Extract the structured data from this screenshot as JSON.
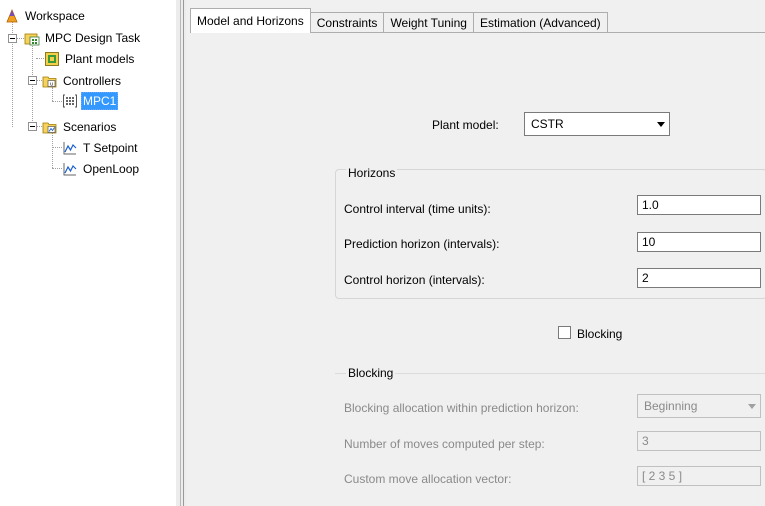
{
  "tree": {
    "workspace": "Workspace",
    "task": "MPC Design Task",
    "plant_models": "Plant models",
    "controllers": "Controllers",
    "controller": "MPC1",
    "scenarios": "Scenarios",
    "scenario_1": "T Setpoint",
    "scenario_2": "OpenLoop"
  },
  "tabs": [
    "Model and Horizons",
    "Constraints",
    "Weight Tuning",
    "Estimation (Advanced)"
  ],
  "plant": {
    "label": "Plant model:",
    "value": "CSTR"
  },
  "horizons": {
    "title": "Horizons",
    "control_interval": {
      "label": "Control interval (time units):",
      "value": "1.0"
    },
    "prediction_horizon": {
      "label": "Prediction horizon (intervals):",
      "value": "10"
    },
    "control_horizon": {
      "label": "Control horizon (intervals):",
      "value": "2"
    }
  },
  "blocking_checkbox": {
    "label": "Blocking",
    "checked": false
  },
  "blocking": {
    "title": "Blocking",
    "allocation": {
      "label": "Blocking allocation within prediction horizon:",
      "value": "Beginning"
    },
    "moves": {
      "label": "Number of moves computed per step:",
      "value": "3"
    },
    "custom": {
      "label": "Custom move allocation vector:",
      "value": "[ 2 3 5 ]"
    }
  },
  "colors": {
    "selection": "#3399ff",
    "panel": "#f0f0f0"
  }
}
